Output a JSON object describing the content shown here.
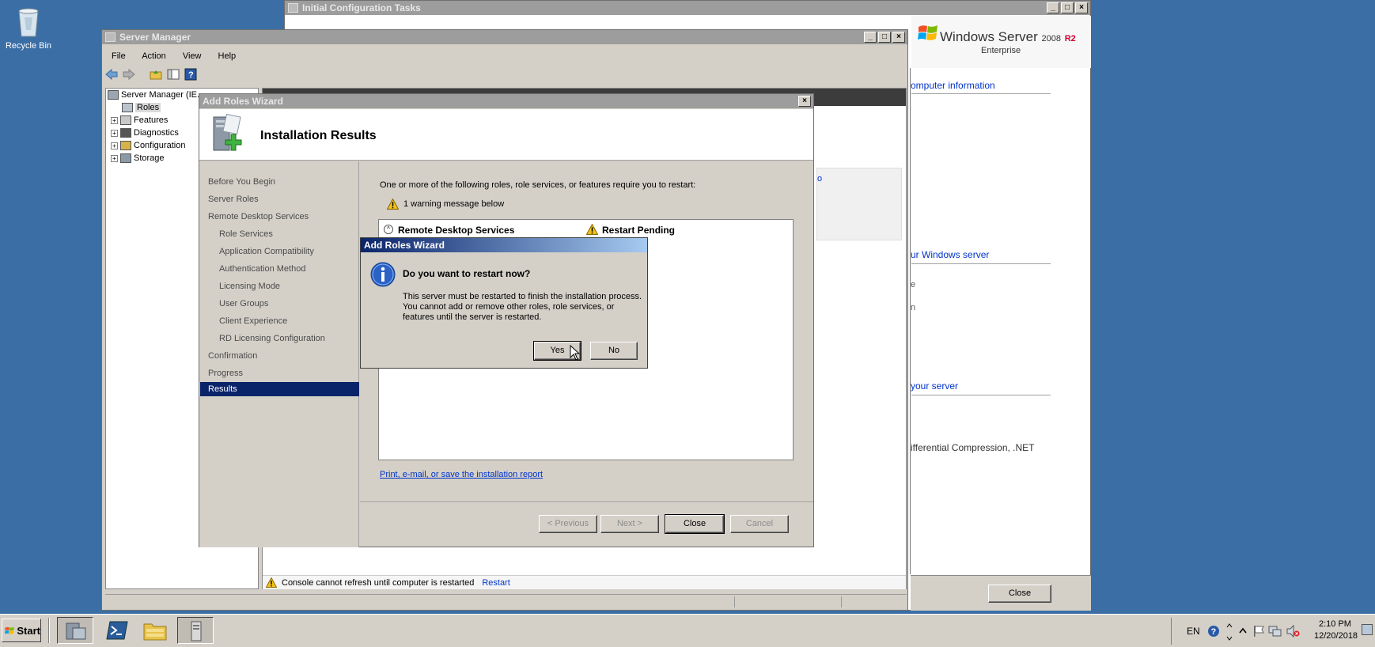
{
  "desktop": {
    "recycle_bin_label": "Recycle Bin"
  },
  "init_config": {
    "title": "Initial Configuration Tasks",
    "brand_title": "Windows Server",
    "brand_version": "2008",
    "brand_r2": "R2",
    "brand_edition": "Enterprise",
    "partial_texts": [
      "omputer information",
      "ur Windows server",
      "e",
      "n",
      "your server",
      "ifferential Compression, .NET"
    ],
    "close_label": "Close"
  },
  "server_manager": {
    "title": "Server Manager",
    "menu": [
      "File",
      "Action",
      "View",
      "Help"
    ],
    "tree_root": "Server Manager (IE...",
    "tree_items": [
      "Roles",
      "Features",
      "Diagnostics",
      "Configuration",
      "Storage"
    ],
    "console_warning": "Console cannot refresh until computer is restarted",
    "restart_link": "Restart",
    "partial_o": "o"
  },
  "wizard": {
    "title": "Add Roles Wizard",
    "heading": "Installation Results",
    "nav": [
      {
        "label": "Before You Begin",
        "sub": false
      },
      {
        "label": "Server Roles",
        "sub": false
      },
      {
        "label": "Remote Desktop Services",
        "sub": false
      },
      {
        "label": "Role Services",
        "sub": true
      },
      {
        "label": "Application Compatibility",
        "sub": true
      },
      {
        "label": "Authentication Method",
        "sub": true
      },
      {
        "label": "Licensing Mode",
        "sub": true
      },
      {
        "label": "User Groups",
        "sub": true
      },
      {
        "label": "Client Experience",
        "sub": true
      },
      {
        "label": "RD Licensing Configuration",
        "sub": true
      },
      {
        "label": "Confirmation",
        "sub": false
      },
      {
        "label": "Progress",
        "sub": false
      },
      {
        "label": "Results",
        "sub": false
      }
    ],
    "intro_text": "One or more of the following roles, role services, or features require you to restart:",
    "warning_count": "1 warning message below",
    "result_role": "Remote Desktop Services",
    "result_status": "Restart Pending",
    "report_link": "Print, e-mail, or save the installation report",
    "buttons": {
      "previous": "< Previous",
      "next": "Next >",
      "close": "Close",
      "cancel": "Cancel"
    }
  },
  "dialog": {
    "title": "Add Roles Wizard",
    "question": "Do you want to restart now?",
    "message": "This server must be restarted to finish the installation process. You cannot add or remove other roles, role services, or features until the server is restarted.",
    "yes": "Yes",
    "no": "No"
  },
  "taskbar": {
    "start": "Start",
    "lang": "EN",
    "time": "2:10 PM",
    "date": "12/20/2018"
  },
  "colors": {
    "desktop": "#3a6ea5",
    "selection": "#0a246a",
    "link": "#0033cc"
  }
}
